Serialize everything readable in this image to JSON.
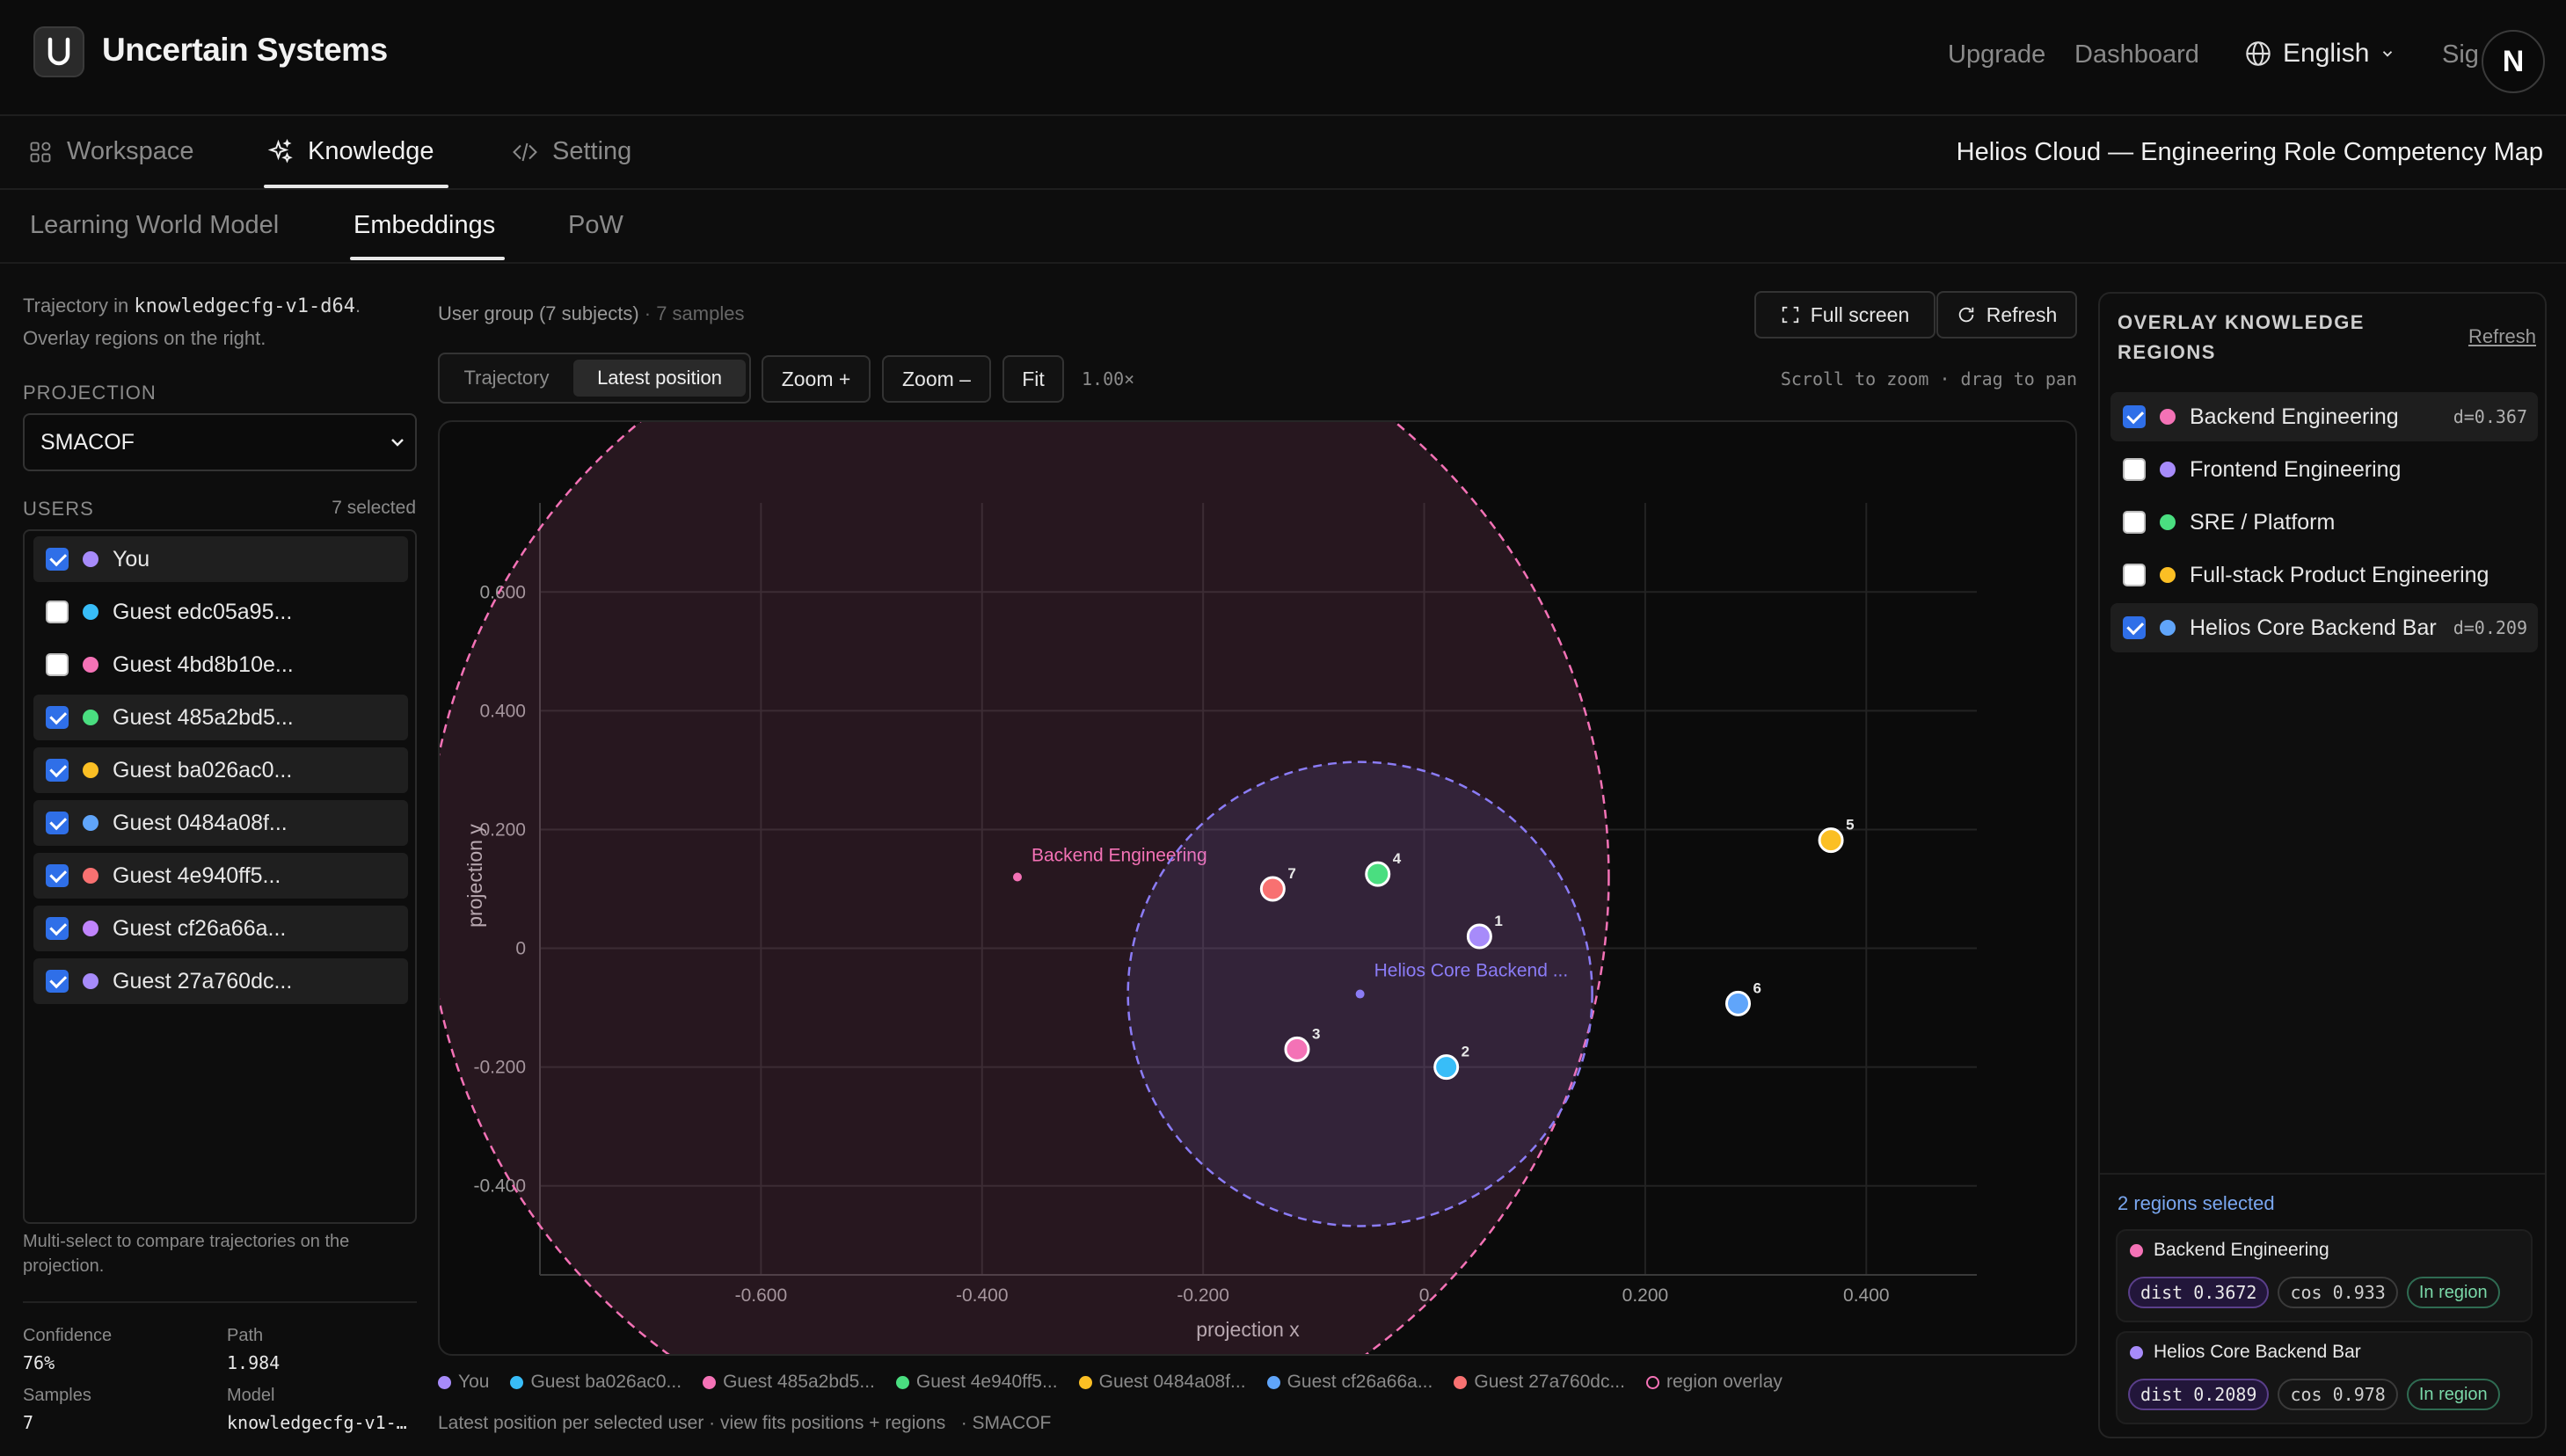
{
  "app": {
    "brand": "Uncertain Systems",
    "upgrade": "Upgrade",
    "dashboard": "Dashboard",
    "language": "English",
    "sign_in": "Sig",
    "avatar_initial": "N"
  },
  "main_tabs": [
    {
      "label": "Workspace"
    },
    {
      "label": "Knowledge"
    },
    {
      "label": "Setting"
    }
  ],
  "map_title": "Helios Cloud — Engineering Role Competency Map",
  "sub_tabs": [
    {
      "label": "Learning World Model"
    },
    {
      "label": "Embeddings"
    },
    {
      "label": "PoW"
    }
  ],
  "left": {
    "desc_prefix": "Trajectory in ",
    "config": "knowledgecfg-v1-d64",
    "desc_suffix": ".",
    "desc_line2": "Overlay regions on the right.",
    "projection_label": "PROJECTION",
    "projection_value": "SMACOF",
    "users_label": "USERS",
    "selected_count": "7 selected",
    "users": [
      {
        "name": "You",
        "checked": true,
        "color": "#a78bfa"
      },
      {
        "name": "Guest edc05a95...",
        "checked": false,
        "color": "#38bdf8"
      },
      {
        "name": "Guest 4bd8b10e...",
        "checked": false,
        "color": "#f472b6"
      },
      {
        "name": "Guest 485a2bd5...",
        "checked": true,
        "color": "#4ade80"
      },
      {
        "name": "Guest ba026ac0...",
        "checked": true,
        "color": "#fbbf24"
      },
      {
        "name": "Guest 0484a08f...",
        "checked": true,
        "color": "#60a5fa"
      },
      {
        "name": "Guest 4e940ff5...",
        "checked": true,
        "color": "#f87171"
      },
      {
        "name": "Guest cf26a66a...",
        "checked": true,
        "color": "#c084fc"
      },
      {
        "name": "Guest 27a760dc...",
        "checked": true,
        "color": "#a78bfa"
      }
    ],
    "hint_line1": "Multi-select to compare trajectories on the",
    "hint_line2": "projection.",
    "stats": {
      "confidence_label": "Confidence",
      "confidence": "76%",
      "path_label": "Path",
      "path": "1.984",
      "samples_label": "Samples",
      "samples": "7",
      "model_label": "Model",
      "model": "knowledgecfg-v1-…"
    }
  },
  "toolbar": {
    "group": "User group (7 subjects)",
    "samples": " · 7 samples",
    "fullscreen": "Full screen",
    "refresh": "Refresh",
    "mode_trajectory": "Trajectory",
    "mode_latest": "Latest position",
    "zoom_in": "Zoom +",
    "zoom_out": "Zoom –",
    "fit": "Fit",
    "zoom_level": "1.00×",
    "hint": "Scroll to zoom · drag to pan"
  },
  "chart_data": {
    "type": "scatter",
    "xlabel": "projection x",
    "ylabel": "projection y",
    "xlim": [
      -0.8,
      0.5
    ],
    "ylim": [
      -0.55,
      0.75
    ],
    "xticks": [
      -0.6,
      -0.4,
      -0.2,
      0,
      0.2,
      0.4
    ],
    "yticks": [
      0.6,
      0.4,
      0.2,
      0,
      -0.2,
      -0.4
    ],
    "xtick_labels": [
      "-0.600",
      "-0.400",
      "-0.200",
      "0",
      "0.200",
      "0.400"
    ],
    "ytick_labels": [
      "0.600",
      "0.400",
      "0.200",
      "0",
      "-0.200",
      "-0.400"
    ],
    "grid": true,
    "points": [
      {
        "label": "1",
        "x": 0.05,
        "y": 0.02,
        "color": "#a78bfa"
      },
      {
        "label": "2",
        "x": 0.02,
        "y": -0.2,
        "color": "#38bdf8"
      },
      {
        "label": "3",
        "x": -0.115,
        "y": -0.17,
        "color": "#f472b6"
      },
      {
        "label": "4",
        "x": -0.042,
        "y": 0.125,
        "color": "#4ade80"
      },
      {
        "label": "5",
        "x": 0.368,
        "y": 0.182,
        "color": "#fbbf24"
      },
      {
        "label": "6",
        "x": 0.284,
        "y": -0.093,
        "color": "#60a5fa"
      },
      {
        "label": "7",
        "x": -0.137,
        "y": 0.1,
        "color": "#f87171"
      }
    ],
    "regions": [
      {
        "name": "Backend Engineering",
        "cx": -0.368,
        "cy": 0.12,
        "r": 0.535,
        "color": "#f472b6"
      },
      {
        "name": "Helios Core Backend ...",
        "cx": -0.058,
        "cy": -0.077,
        "r": 0.21,
        "color": "#8b7cf6"
      }
    ],
    "legend": [
      {
        "name": "You",
        "color": "#a78bfa"
      },
      {
        "name": "Guest ba026ac0...",
        "color": "#38bdf8"
      },
      {
        "name": "Guest 485a2bd5...",
        "color": "#f472b6"
      },
      {
        "name": "Guest 4e940ff5...",
        "color": "#4ade80"
      },
      {
        "name": "Guest 0484a08f...",
        "color": "#fbbf24"
      },
      {
        "name": "Guest cf26a66a...",
        "color": "#60a5fa"
      },
      {
        "name": "Guest 27a760dc...",
        "color": "#f87171"
      },
      {
        "name": "region overlay",
        "color": "#f472b6"
      }
    ]
  },
  "footer_caption": "Latest position per selected user · view fits positions + regions   · SMACOF",
  "right": {
    "title_line1": "OVERLAY KNOWLEDGE",
    "title_line2": "REGIONS",
    "refresh": "Refresh",
    "regions": [
      {
        "name": "Backend Engineering",
        "checked": true,
        "color": "#f472b6",
        "d": "d=0.367"
      },
      {
        "name": "Frontend Engineering",
        "checked": false,
        "color": "#a78bfa",
        "d": ""
      },
      {
        "name": "SRE / Platform",
        "checked": false,
        "color": "#4ade80",
        "d": ""
      },
      {
        "name": "Full-stack Product Engineering",
        "checked": false,
        "color": "#fbbf24",
        "d": ""
      },
      {
        "name": "Helios Core Backend Bar",
        "checked": true,
        "color": "#60a5fa",
        "d": "d=0.209"
      }
    ],
    "summary": "2 regions selected",
    "cards": [
      {
        "name": "Backend Engineering",
        "color": "#f472b6",
        "dist": "dist 0.3672",
        "cos": "cos 0.933",
        "status": "In region"
      },
      {
        "name": "Helios Core Backend Bar",
        "color": "#a78bfa",
        "dist": "dist 0.2089",
        "cos": "cos 0.978",
        "status": "In region"
      }
    ]
  }
}
